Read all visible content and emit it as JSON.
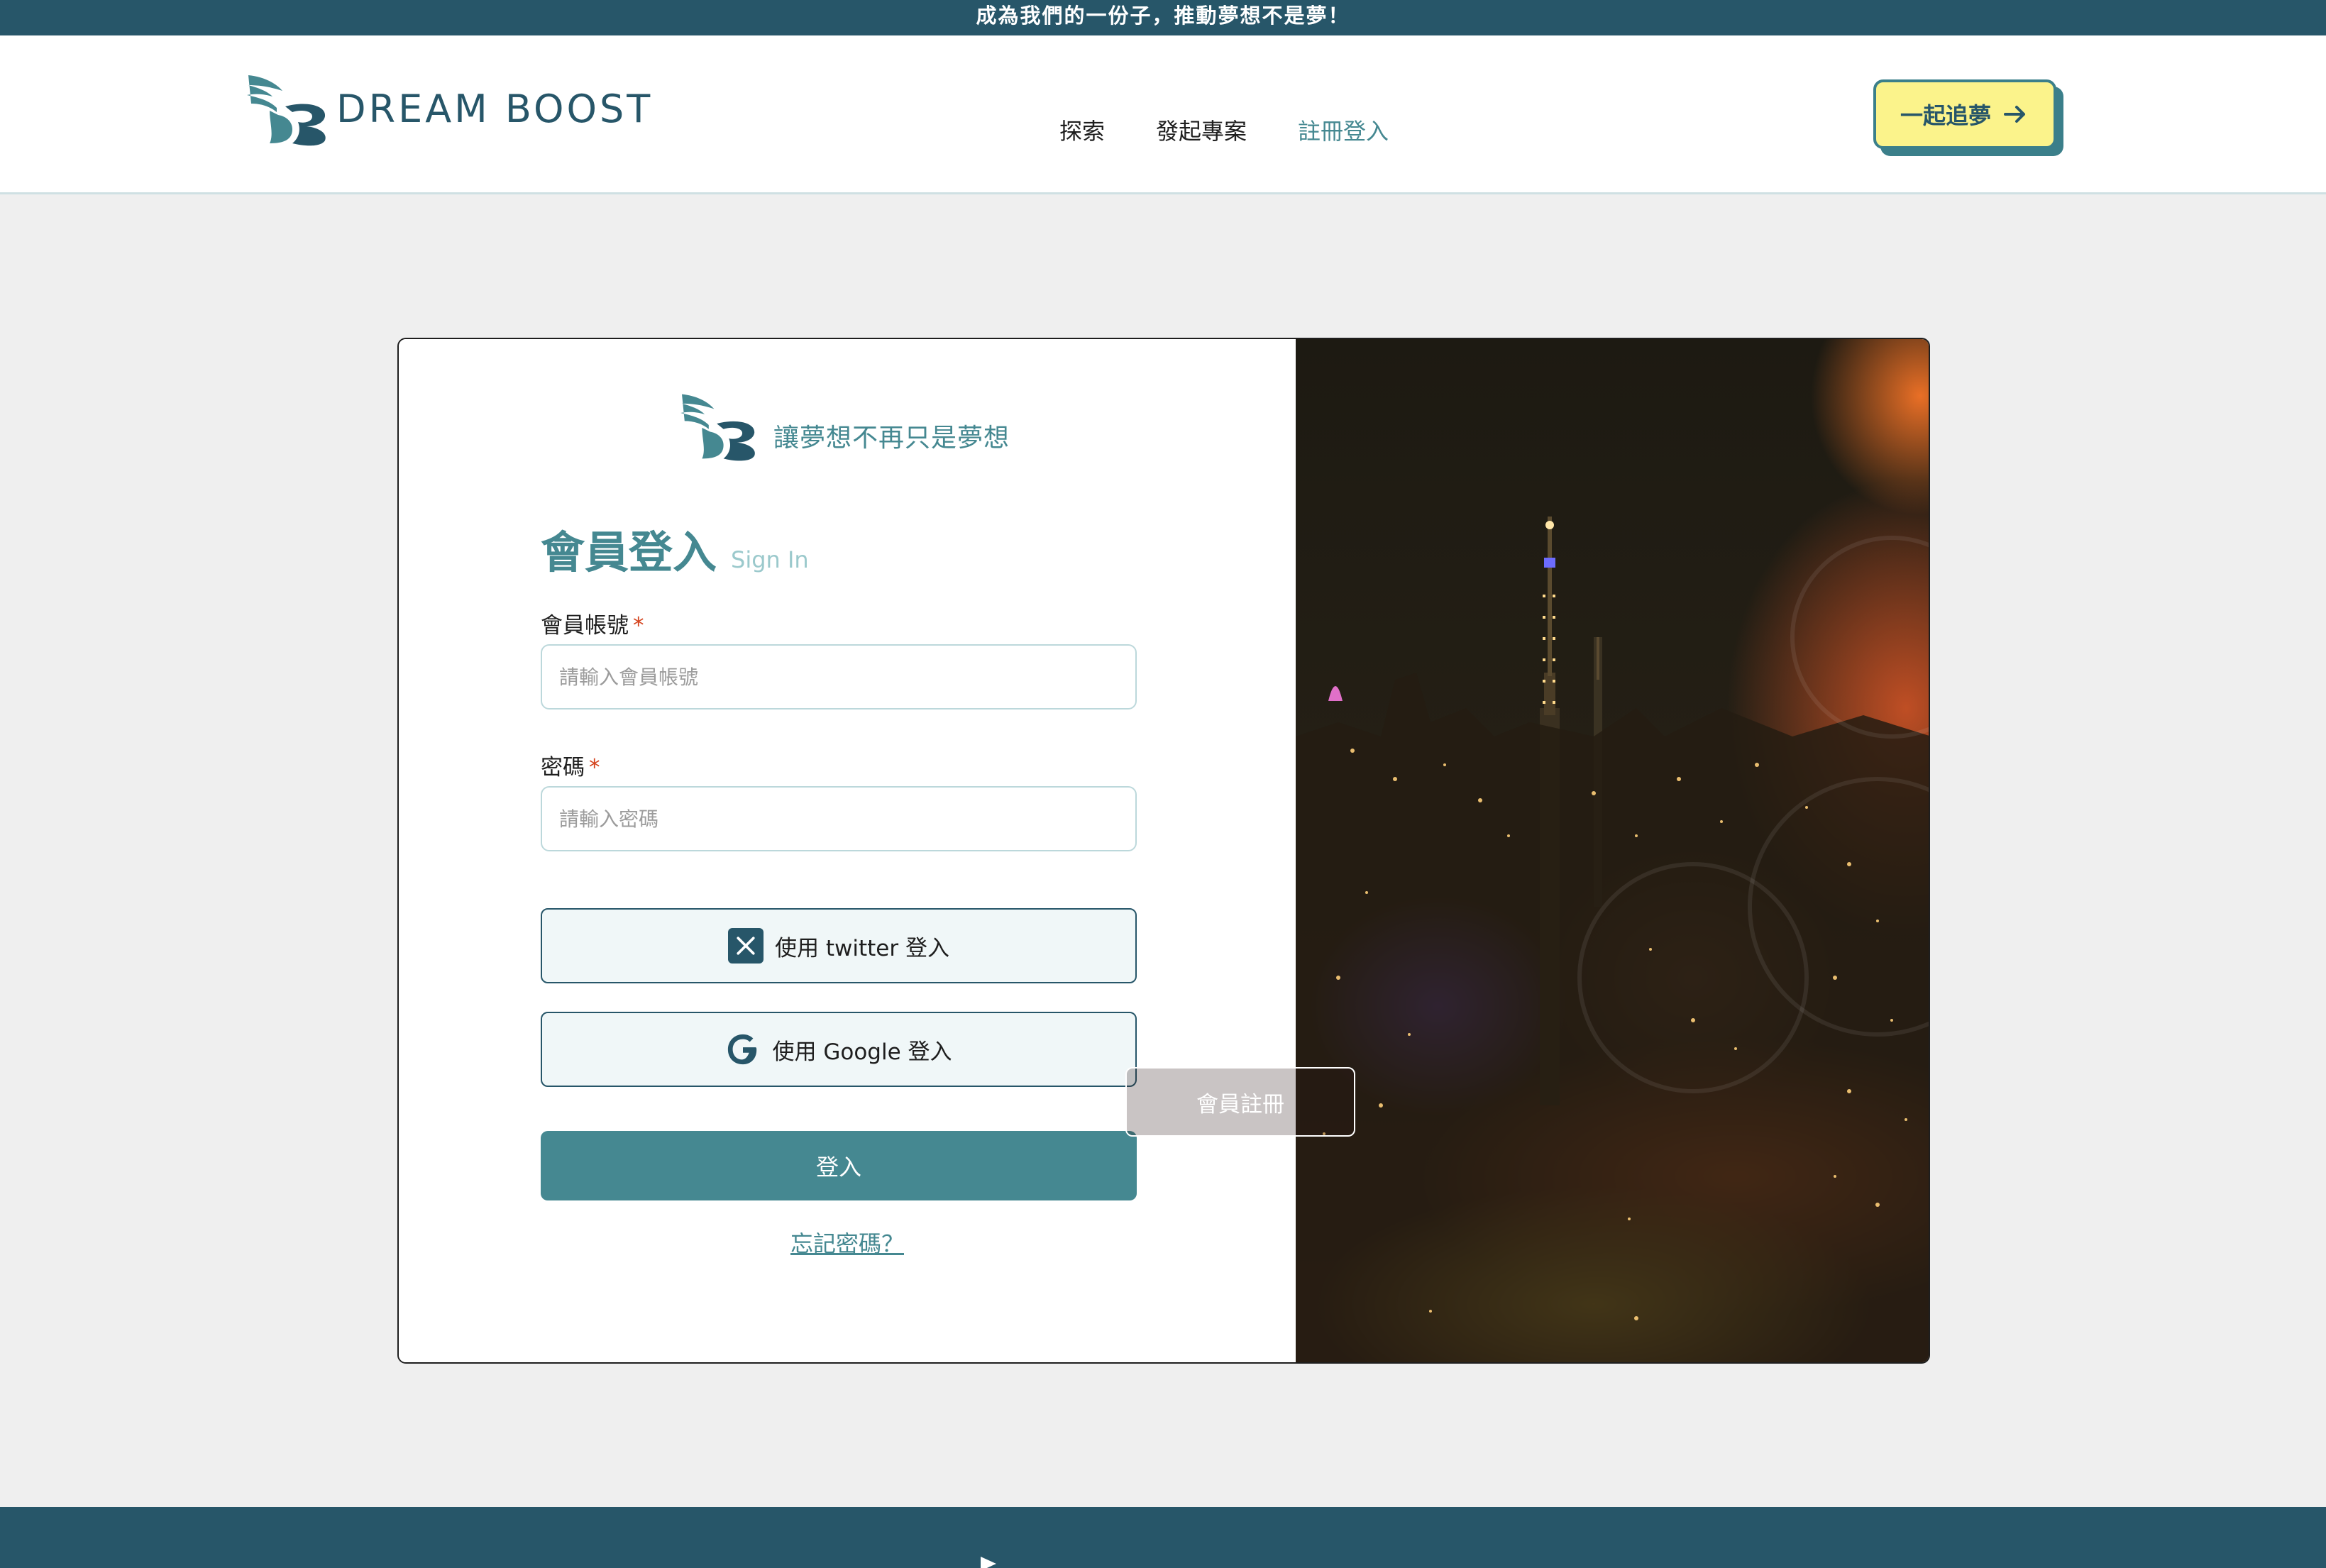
{
  "announcement": "成為我們的一份子，推動夢想不是夢！",
  "header": {
    "logo_text": "DREAM BOOST",
    "nav": [
      "探索",
      "發起專案",
      "註冊登入"
    ],
    "active_nav": "註冊登入",
    "cta_label": "一起追夢",
    "cta_icon": "arrow-right-icon"
  },
  "login": {
    "slogan": "讓夢想不再只是夢想",
    "title": "會員登入",
    "subtitle": "Sign In",
    "account": {
      "label": "會員帳號",
      "required_mark": "*",
      "placeholder": "請輸入會員帳號",
      "value": ""
    },
    "password": {
      "label": "密碼",
      "required_mark": "*",
      "placeholder": "請輸入密碼",
      "value": ""
    },
    "twitter_button": "使用 twitter 登入",
    "google_button": "使用 Google 登入",
    "submit_button": "登入",
    "forgot_link": "忘記密碼？"
  },
  "side": {
    "register_button": "會員註冊"
  },
  "colors": {
    "primary_dark": "#275669",
    "primary": "#458891",
    "accent_yellow": "#fbf38b",
    "required_red": "#d4421c"
  }
}
